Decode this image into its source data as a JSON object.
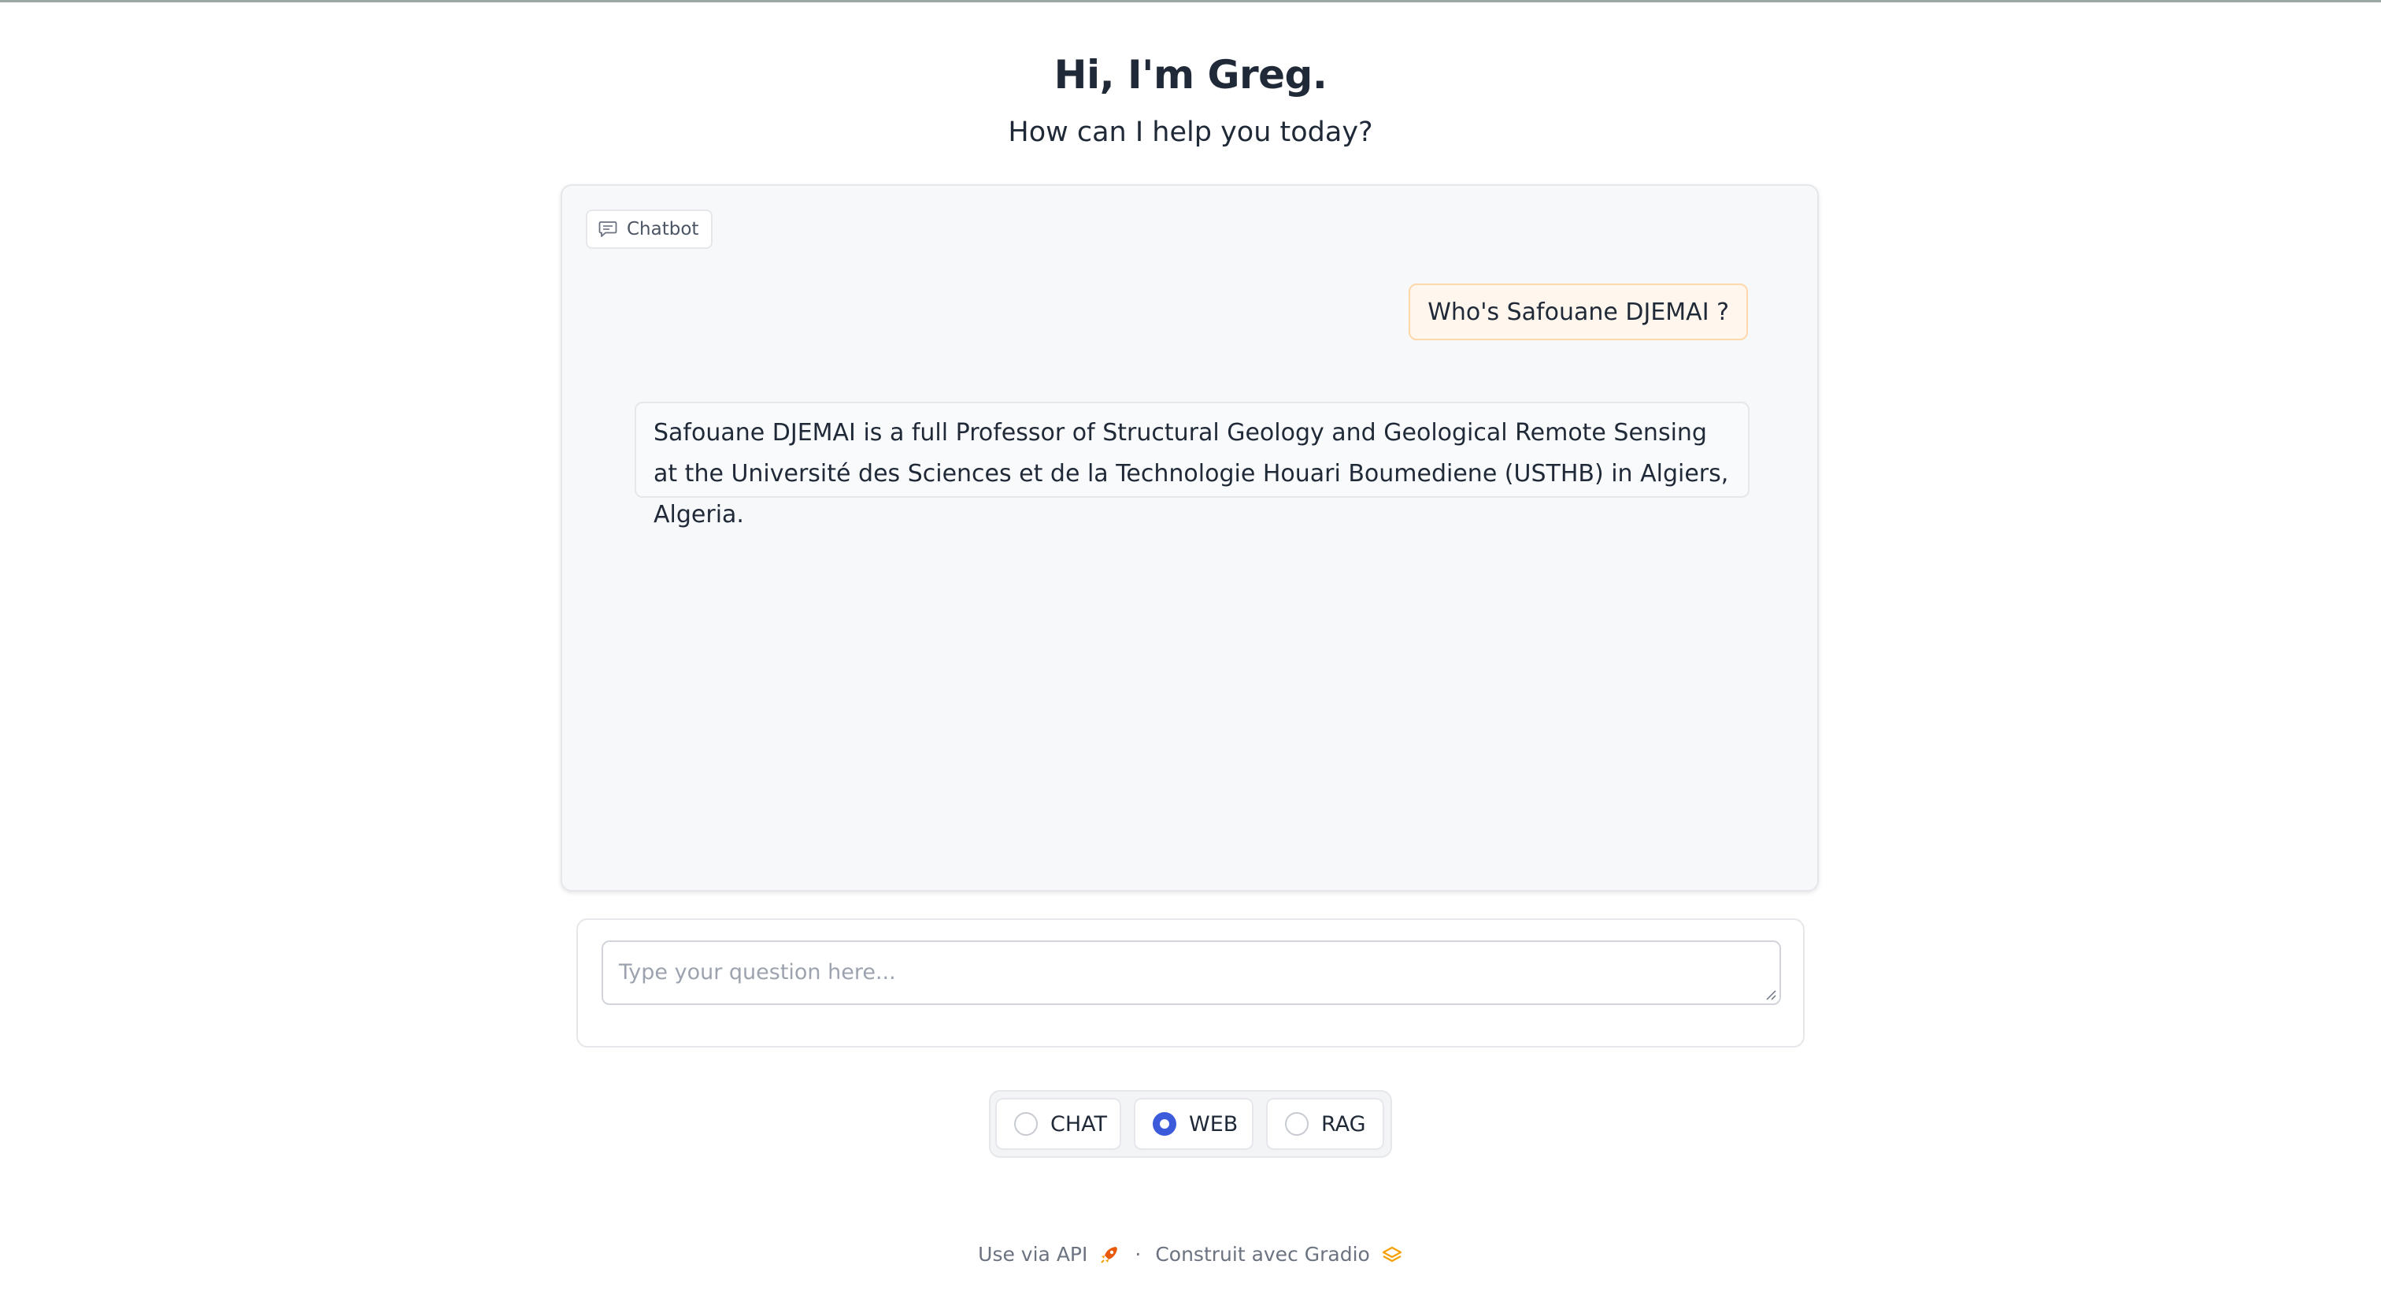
{
  "header": {
    "title": "Hi, I'm Greg.",
    "subtitle": "How can I help you today?"
  },
  "chatbot": {
    "label": "Chatbot",
    "label_icon": "chat-bubble-icon",
    "messages": [
      {
        "role": "user",
        "text": "Who's Safouane DJEMAI ?"
      },
      {
        "role": "assistant",
        "text": "Safouane DJEMAI is a full Professor of Structural Geology and Geological Remote Sensing at the Université des Sciences et de la Technologie Houari Boumediene (USTHB) in Algiers, Algeria."
      }
    ]
  },
  "input": {
    "value": "",
    "placeholder": "Type your question here..."
  },
  "modes": {
    "options": [
      "CHAT",
      "WEB",
      "RAG"
    ],
    "selected": "WEB"
  },
  "footer": {
    "api_label": "Use via API",
    "api_icon": "rocket-icon",
    "separator": "·",
    "built_label": "Construit avec Gradio",
    "built_icon": "gradio-logo-icon"
  },
  "colors": {
    "accent": "#3b5bdb",
    "user_bubble_bg": "#fff7ed",
    "user_bubble_border": "#fed7aa"
  }
}
